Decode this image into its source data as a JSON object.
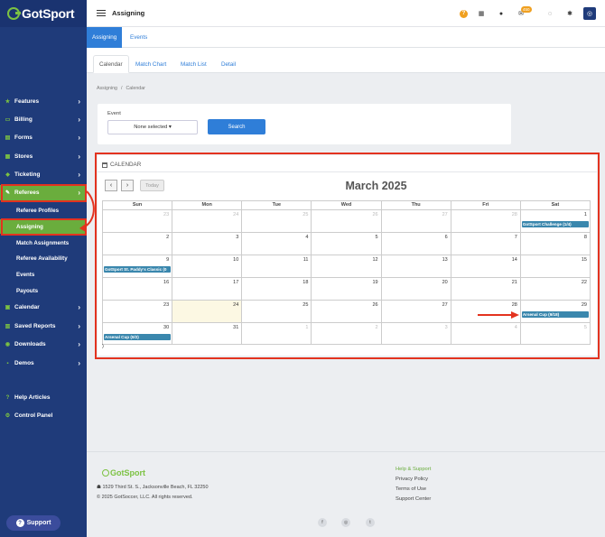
{
  "app": {
    "logo_text": "GotSport"
  },
  "sidebar": {
    "items": [
      {
        "label": "Features",
        "icon": "star-icon"
      },
      {
        "label": "Billing",
        "icon": "card-icon"
      },
      {
        "label": "Forms",
        "icon": "doc-icon"
      },
      {
        "label": "Stores",
        "icon": "store-icon"
      },
      {
        "label": "Ticketing",
        "icon": "ticket-icon"
      },
      {
        "label": "Referees",
        "icon": "whistle-icon"
      }
    ],
    "referee_sub": [
      "Referee Profiles",
      "Assigning",
      "Match Assignments",
      "Referee Availability",
      "Events",
      "Payouts"
    ],
    "items2": [
      {
        "label": "Calendar",
        "icon": "calendar-icon"
      },
      {
        "label": "Saved Reports",
        "icon": "reports-icon"
      },
      {
        "label": "Downloads",
        "icon": "download-icon"
      },
      {
        "label": "Demos",
        "icon": "demo-icon"
      }
    ],
    "bottom": [
      {
        "label": "Help Articles",
        "icon": "help-icon"
      },
      {
        "label": "Control Panel",
        "icon": "settings-icon"
      }
    ],
    "support_label": "Support"
  },
  "header": {
    "title": "Assigning",
    "mail_badge": "450"
  },
  "tabs": [
    "Assigning",
    "Events"
  ],
  "subtabs": [
    "Calendar",
    "Match Chart",
    "Match List",
    "Detail"
  ],
  "breadcrumb": [
    "Assigning",
    "/",
    "Calendar"
  ],
  "event_filter": {
    "label": "Event",
    "select_value": "None selected ▾",
    "search_label": "Search"
  },
  "calendar": {
    "header_label": "CALENDAR",
    "today_label": "Today",
    "month_title": "March 2025",
    "days_of_week": [
      "Sun",
      "Mon",
      "Tue",
      "Wed",
      "Thu",
      "Fri",
      "Sat"
    ],
    "weeks": [
      [
        {
          "n": "23",
          "other": true
        },
        {
          "n": "24",
          "other": true
        },
        {
          "n": "25",
          "other": true
        },
        {
          "n": "26",
          "other": true
        },
        {
          "n": "27",
          "other": true
        },
        {
          "n": "28",
          "other": true
        },
        {
          "n": "1",
          "event": "GotSport Challenge (1/4)"
        }
      ],
      [
        {
          "n": "2"
        },
        {
          "n": "3"
        },
        {
          "n": "4"
        },
        {
          "n": "5"
        },
        {
          "n": "6"
        },
        {
          "n": "7"
        },
        {
          "n": "8"
        }
      ],
      [
        {
          "n": "9",
          "event": "GotSport St. Paddy's Classic (0"
        },
        {
          "n": "10"
        },
        {
          "n": "11"
        },
        {
          "n": "12"
        },
        {
          "n": "13"
        },
        {
          "n": "14"
        },
        {
          "n": "15"
        }
      ],
      [
        {
          "n": "16"
        },
        {
          "n": "17"
        },
        {
          "n": "18"
        },
        {
          "n": "19"
        },
        {
          "n": "20"
        },
        {
          "n": "21"
        },
        {
          "n": "22"
        }
      ],
      [
        {
          "n": "23"
        },
        {
          "n": "24",
          "today": true
        },
        {
          "n": "25"
        },
        {
          "n": "26"
        },
        {
          "n": "27"
        },
        {
          "n": "28"
        },
        {
          "n": "29",
          "event": "Arsenal Cup (9/18)"
        }
      ],
      [
        {
          "n": "30",
          "event": "Arsenal Cup (0/2)"
        },
        {
          "n": "31"
        },
        {
          "n": "1",
          "other": true
        },
        {
          "n": "2",
          "other": true
        },
        {
          "n": "3",
          "other": true
        },
        {
          "n": "4",
          "other": true
        },
        {
          "n": "5",
          "other": true
        }
      ]
    ],
    "trailing_text": ")"
  },
  "footer": {
    "logo_text": "GotSport",
    "address": "☗ 1529 Third St. S., Jacksonville Beach, FL 32250",
    "copyright": "© 2025 GotSoccer, LLC. All rights reserved.",
    "links": [
      "Help & Support",
      "Privacy Policy",
      "Terms of Use",
      "Support Center"
    ],
    "social": [
      "f",
      "◎",
      "t"
    ]
  },
  "colors": {
    "brand_green": "#7cc242",
    "sidebar": "#1f3b7a",
    "primary": "#2f7ed8",
    "highlight": "#e3331f",
    "event": "#3a87ad"
  }
}
